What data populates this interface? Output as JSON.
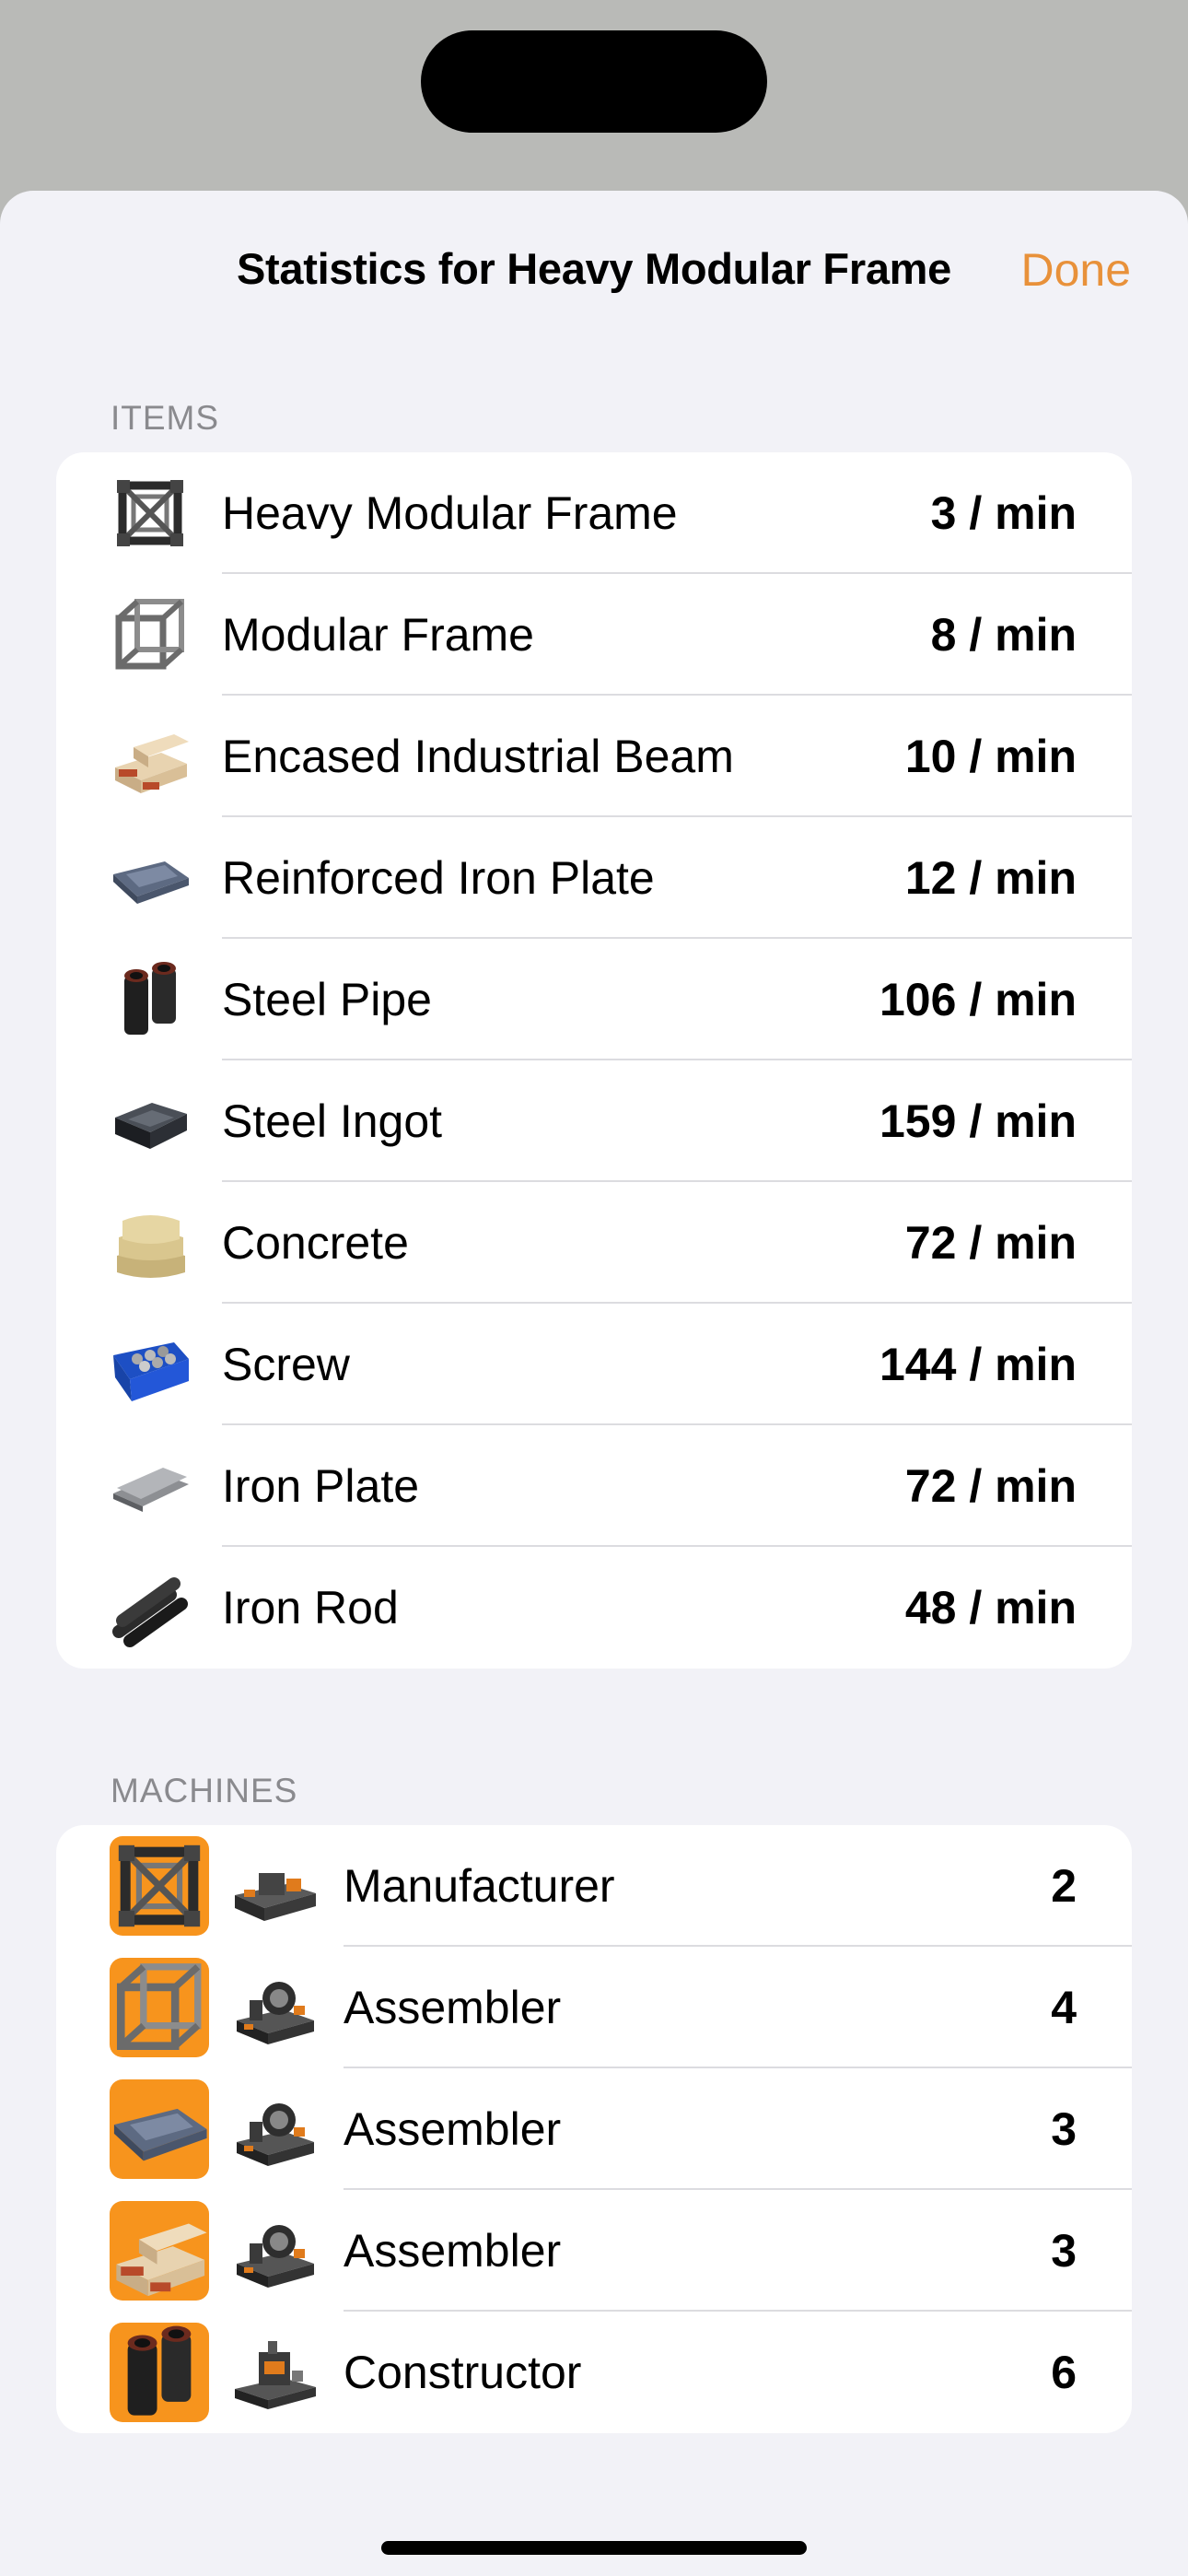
{
  "header": {
    "title": "Statistics for Heavy Modular Frame",
    "done_label": "Done"
  },
  "items": {
    "header": "ITEMS",
    "rows": [
      {
        "name": "Heavy Modular Frame",
        "rate": "3 / min",
        "icon": "heavy-modular-frame-icon"
      },
      {
        "name": "Modular Frame",
        "rate": "8 / min",
        "icon": "modular-frame-icon"
      },
      {
        "name": "Encased Industrial Beam",
        "rate": "10 / min",
        "icon": "encased-industrial-beam-icon"
      },
      {
        "name": "Reinforced Iron Plate",
        "rate": "12 / min",
        "icon": "reinforced-iron-plate-icon"
      },
      {
        "name": "Steel Pipe",
        "rate": "106 / min",
        "icon": "steel-pipe-icon"
      },
      {
        "name": "Steel Ingot",
        "rate": "159 / min",
        "icon": "steel-ingot-icon"
      },
      {
        "name": "Concrete",
        "rate": "72 / min",
        "icon": "concrete-icon"
      },
      {
        "name": "Screw",
        "rate": "144 / min",
        "icon": "screw-icon"
      },
      {
        "name": "Iron Plate",
        "rate": "72 / min",
        "icon": "iron-plate-icon"
      },
      {
        "name": "Iron Rod",
        "rate": "48 / min",
        "icon": "iron-rod-icon"
      }
    ]
  },
  "machines": {
    "header": "MACHINES",
    "rows": [
      {
        "name": "Manufacturer",
        "count": "2",
        "product_icon": "heavy-modular-frame-icon",
        "machine_icon": "manufacturer-icon"
      },
      {
        "name": "Assembler",
        "count": "4",
        "product_icon": "modular-frame-icon",
        "machine_icon": "assembler-icon"
      },
      {
        "name": "Assembler",
        "count": "3",
        "product_icon": "reinforced-iron-plate-icon",
        "machine_icon": "assembler-icon"
      },
      {
        "name": "Assembler",
        "count": "3",
        "product_icon": "encased-industrial-beam-icon",
        "machine_icon": "assembler-icon"
      },
      {
        "name": "Constructor",
        "count": "6",
        "product_icon": "steel-pipe-icon",
        "machine_icon": "constructor-icon"
      }
    ]
  },
  "colors": {
    "accent": "#e8913a",
    "badge": "#f7941d",
    "sheet_bg": "#f2f2f7"
  }
}
